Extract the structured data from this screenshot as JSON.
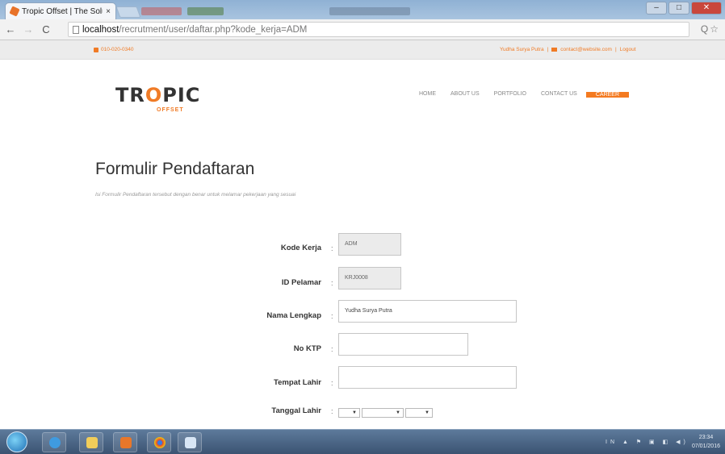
{
  "browser": {
    "tab_title": "Tropic Offset | The Solutio",
    "tab_close": "×",
    "url_host": "localhost",
    "url_path": "/recrutment/user/daftar.php?kode_kerja=ADM",
    "window_controls": {
      "minimize": "–",
      "maximize": "□",
      "close": "✕"
    },
    "address_icons": "Q☆"
  },
  "topstrip": {
    "phone": "010-020-0340",
    "user_link": "Yudha Surya Putra",
    "separator": "|",
    "email": "contact@website.com",
    "logout": "Logout"
  },
  "logo": {
    "text_a": "TR",
    "text_o": "O",
    "text_b": "PIC",
    "sub": "OFFSET"
  },
  "nav": {
    "items": [
      "HOME",
      "ABOUT US",
      "PORTFOLIO",
      "CONTACT US"
    ],
    "active": "CAREER"
  },
  "page": {
    "heading": "Formulir Pendaftaran",
    "subtitle": "Isi Formulir Pendaftaran tersebut dengan benar untuk melamar pekerjaan yang sesuai"
  },
  "form": {
    "colon": ":",
    "kode_kerja": {
      "label": "Kode Kerja",
      "value": "ADM"
    },
    "id_pelamar": {
      "label": "ID Pelamar",
      "value": "KRJ0008"
    },
    "nama_lengkap": {
      "label": "Nama Lengkap",
      "value": "Yudha Surya Putra"
    },
    "no_ktp": {
      "label": "No KTP",
      "value": ""
    },
    "tempat_lahir": {
      "label": "Tempat Lahir",
      "value": ""
    },
    "tanggal_lahir": {
      "label": "Tanggal Lahir",
      "arrow": "▼"
    }
  },
  "taskbar": {
    "time": "23:34",
    "date": "07/01/2016",
    "tray": "IN ▲ ⚑ ▣ ◧ ◀)"
  },
  "colors": {
    "accent": "#f47a20",
    "heading": "#333333",
    "taskbar": "#3b5372"
  }
}
